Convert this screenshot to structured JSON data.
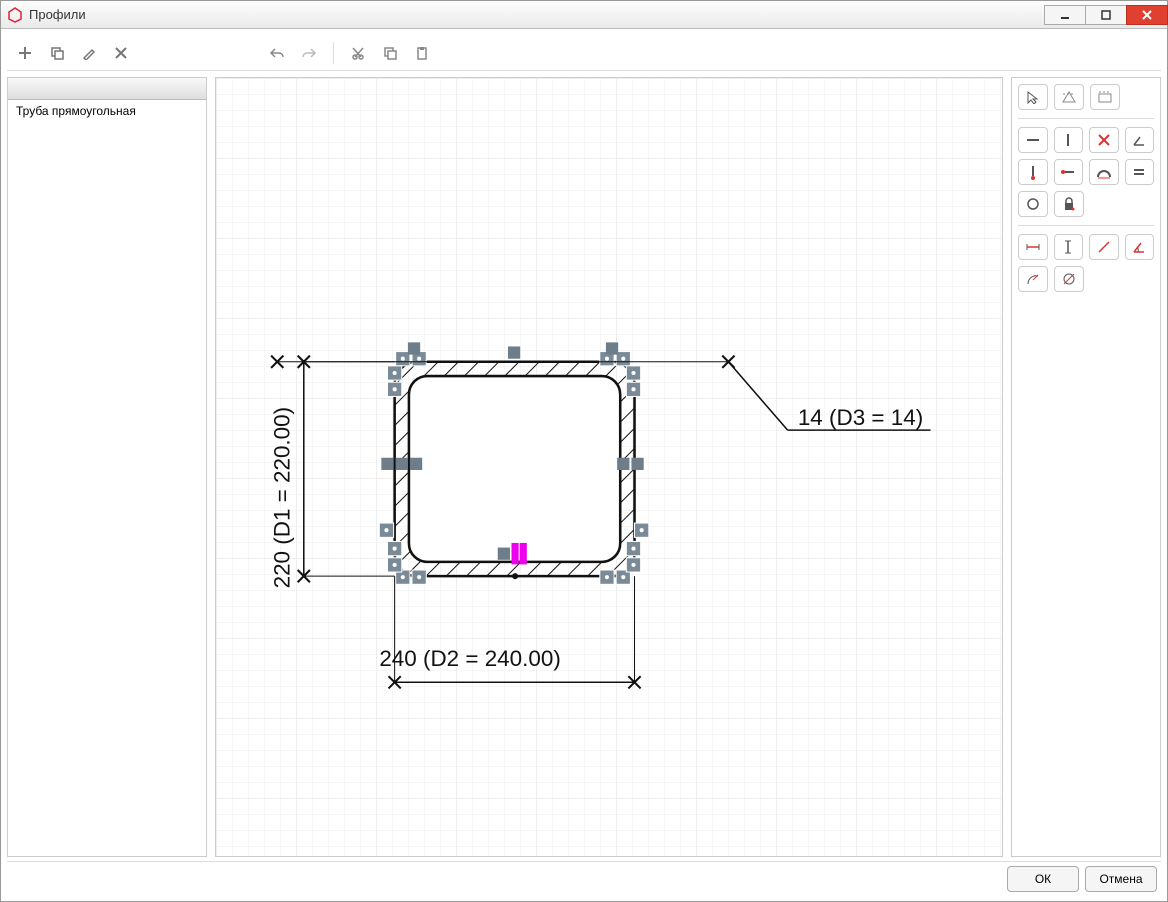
{
  "window": {
    "title": "Профили"
  },
  "sidebar": {
    "items": [
      "Труба прямоугольная"
    ]
  },
  "dims": {
    "d1": "220 (D1 = 220.00)",
    "d2": "240 (D2 = 240.00)",
    "d3": "14 (D3 = 14)"
  },
  "toolbar": {
    "add": "add-icon",
    "clone": "clone-icon",
    "edit": "edit-icon",
    "delete": "delete-icon",
    "undo": "undo-icon",
    "redo": "redo-icon",
    "cut": "cut-icon",
    "copy": "copy-icon",
    "paste": "paste-icon"
  },
  "buttons": {
    "ok": "ОК",
    "cancel": "Отмена"
  },
  "right_tools": {
    "r0": [
      "select",
      "line-construction",
      "rect-construction"
    ],
    "r1": [
      "line-h",
      "line-v",
      "line-diag",
      "line-angle"
    ],
    "r2": [
      "point",
      "segment",
      "arc",
      "equal"
    ],
    "r3": [
      "circle",
      "lock"
    ],
    "r4": [
      "dim-h",
      "dim-v",
      "dim-diag",
      "dim-angle"
    ],
    "r5": [
      "dim-radius",
      "dim-diameter"
    ]
  }
}
